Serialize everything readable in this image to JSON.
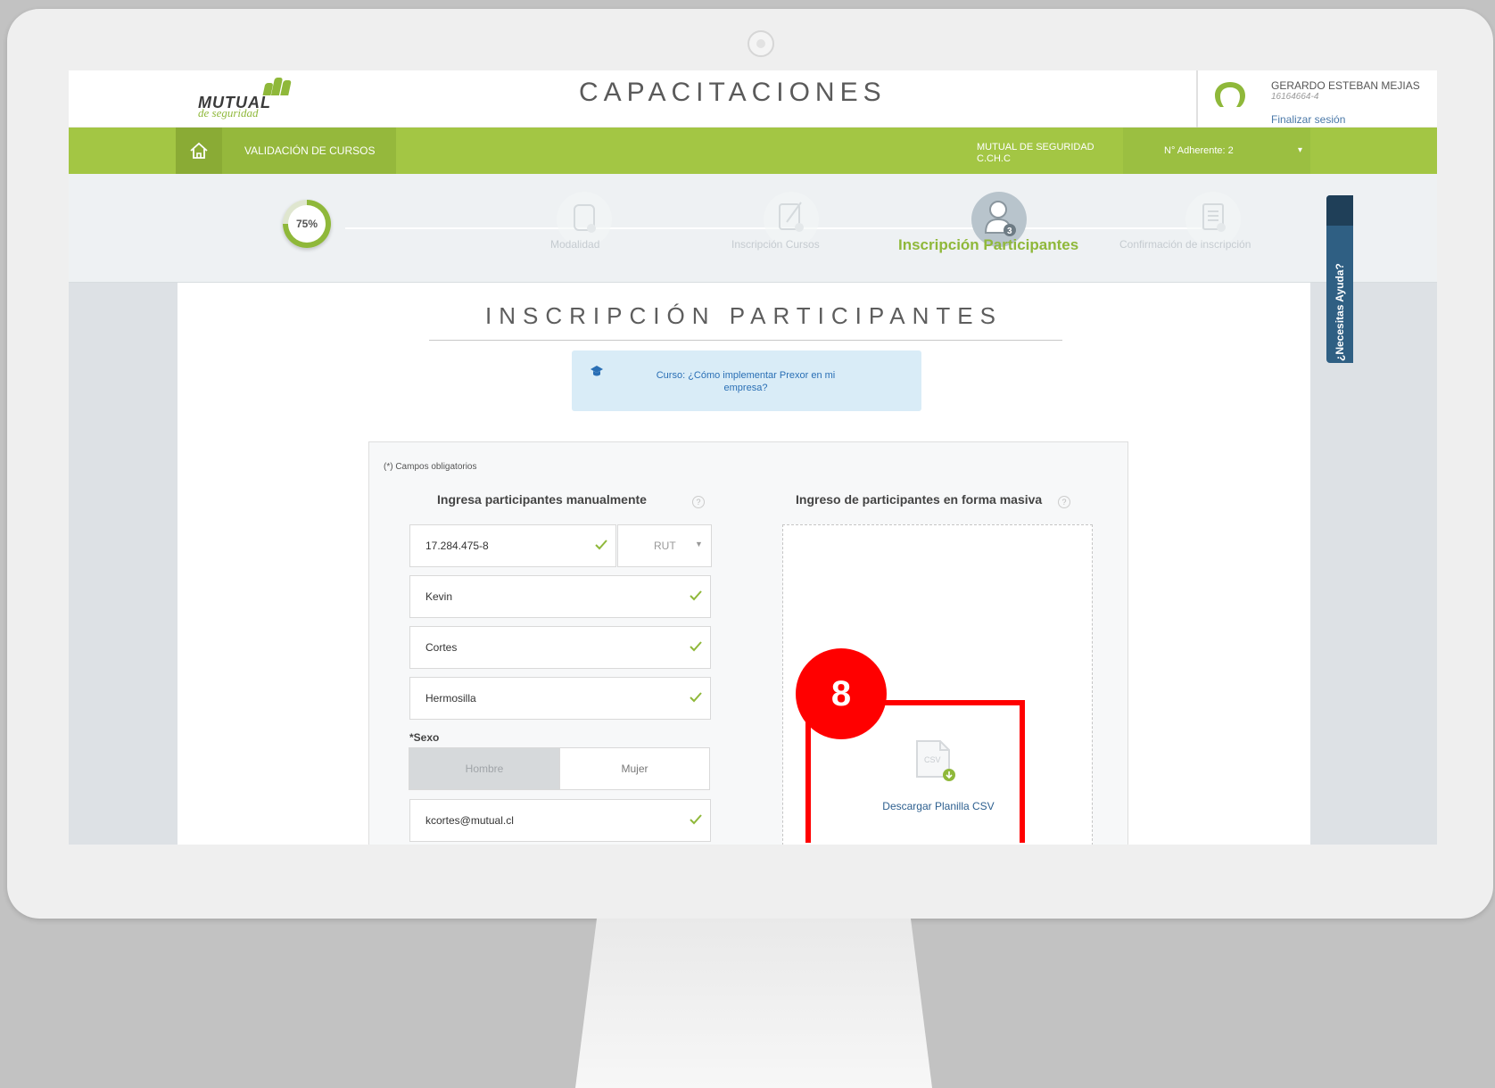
{
  "app": {
    "logo_main": "MUTUAL",
    "logo_sub": "de seguridad",
    "title": "CAPACITACIONES"
  },
  "user": {
    "name": "GERARDO ESTEBAN MEJIAS",
    "rut": "16164664-4",
    "logout": "Finalizar sesión"
  },
  "nav": {
    "home_icon": "home-icon",
    "validation": "VALIDACIÓN DE CURSOS",
    "company_line1": "MUTUAL DE SEGURIDAD",
    "company_line2": "C.CH.C",
    "adherente": "N° Adherente: 2",
    "caret": "▾"
  },
  "stepper": {
    "progress": 0.75,
    "progress_label": "75%",
    "steps": [
      {
        "label": "Modalidad",
        "icon": "tablet-icon",
        "active": false
      },
      {
        "label": "Inscripción Cursos",
        "icon": "edit-document-icon",
        "active": false
      },
      {
        "label": "Inscripción Participantes",
        "icon": "participant-icon",
        "active": true
      },
      {
        "label": "Confirmación de inscripción",
        "icon": "clipboard-icon",
        "active": false
      }
    ]
  },
  "side_tab": {
    "label": "¿Necesitas Ayuda?"
  },
  "page": {
    "title": "INSCRIPCIÓN PARTICIPANTES",
    "course": "Curso: ¿Cómo implementar Prexor en mi empresa?"
  },
  "form": {
    "required_note": "(*) Campos obligatorios",
    "manual_title": "Ingresa participantes manualmente",
    "mass_title": "Ingreso de participantes en forma masiva",
    "rut_value": "17.284.475-8",
    "rut_type": "RUT",
    "first_name": "Kevin",
    "last_name_1": "Cortes",
    "last_name_2": "Hermosilla",
    "sexo_label": "*Sexo",
    "sexo_male": "Hombre",
    "sexo_female": "Mujer",
    "email": "kcortes@mutual.cl",
    "csv_icon_text": "CSV",
    "csv_label": "Descargar Planilla CSV"
  },
  "annotation": {
    "number": "8",
    "color": "#ff0000"
  },
  "colors": {
    "brand_green": "#a3c644",
    "accent_blue": "#2a6fb5"
  }
}
